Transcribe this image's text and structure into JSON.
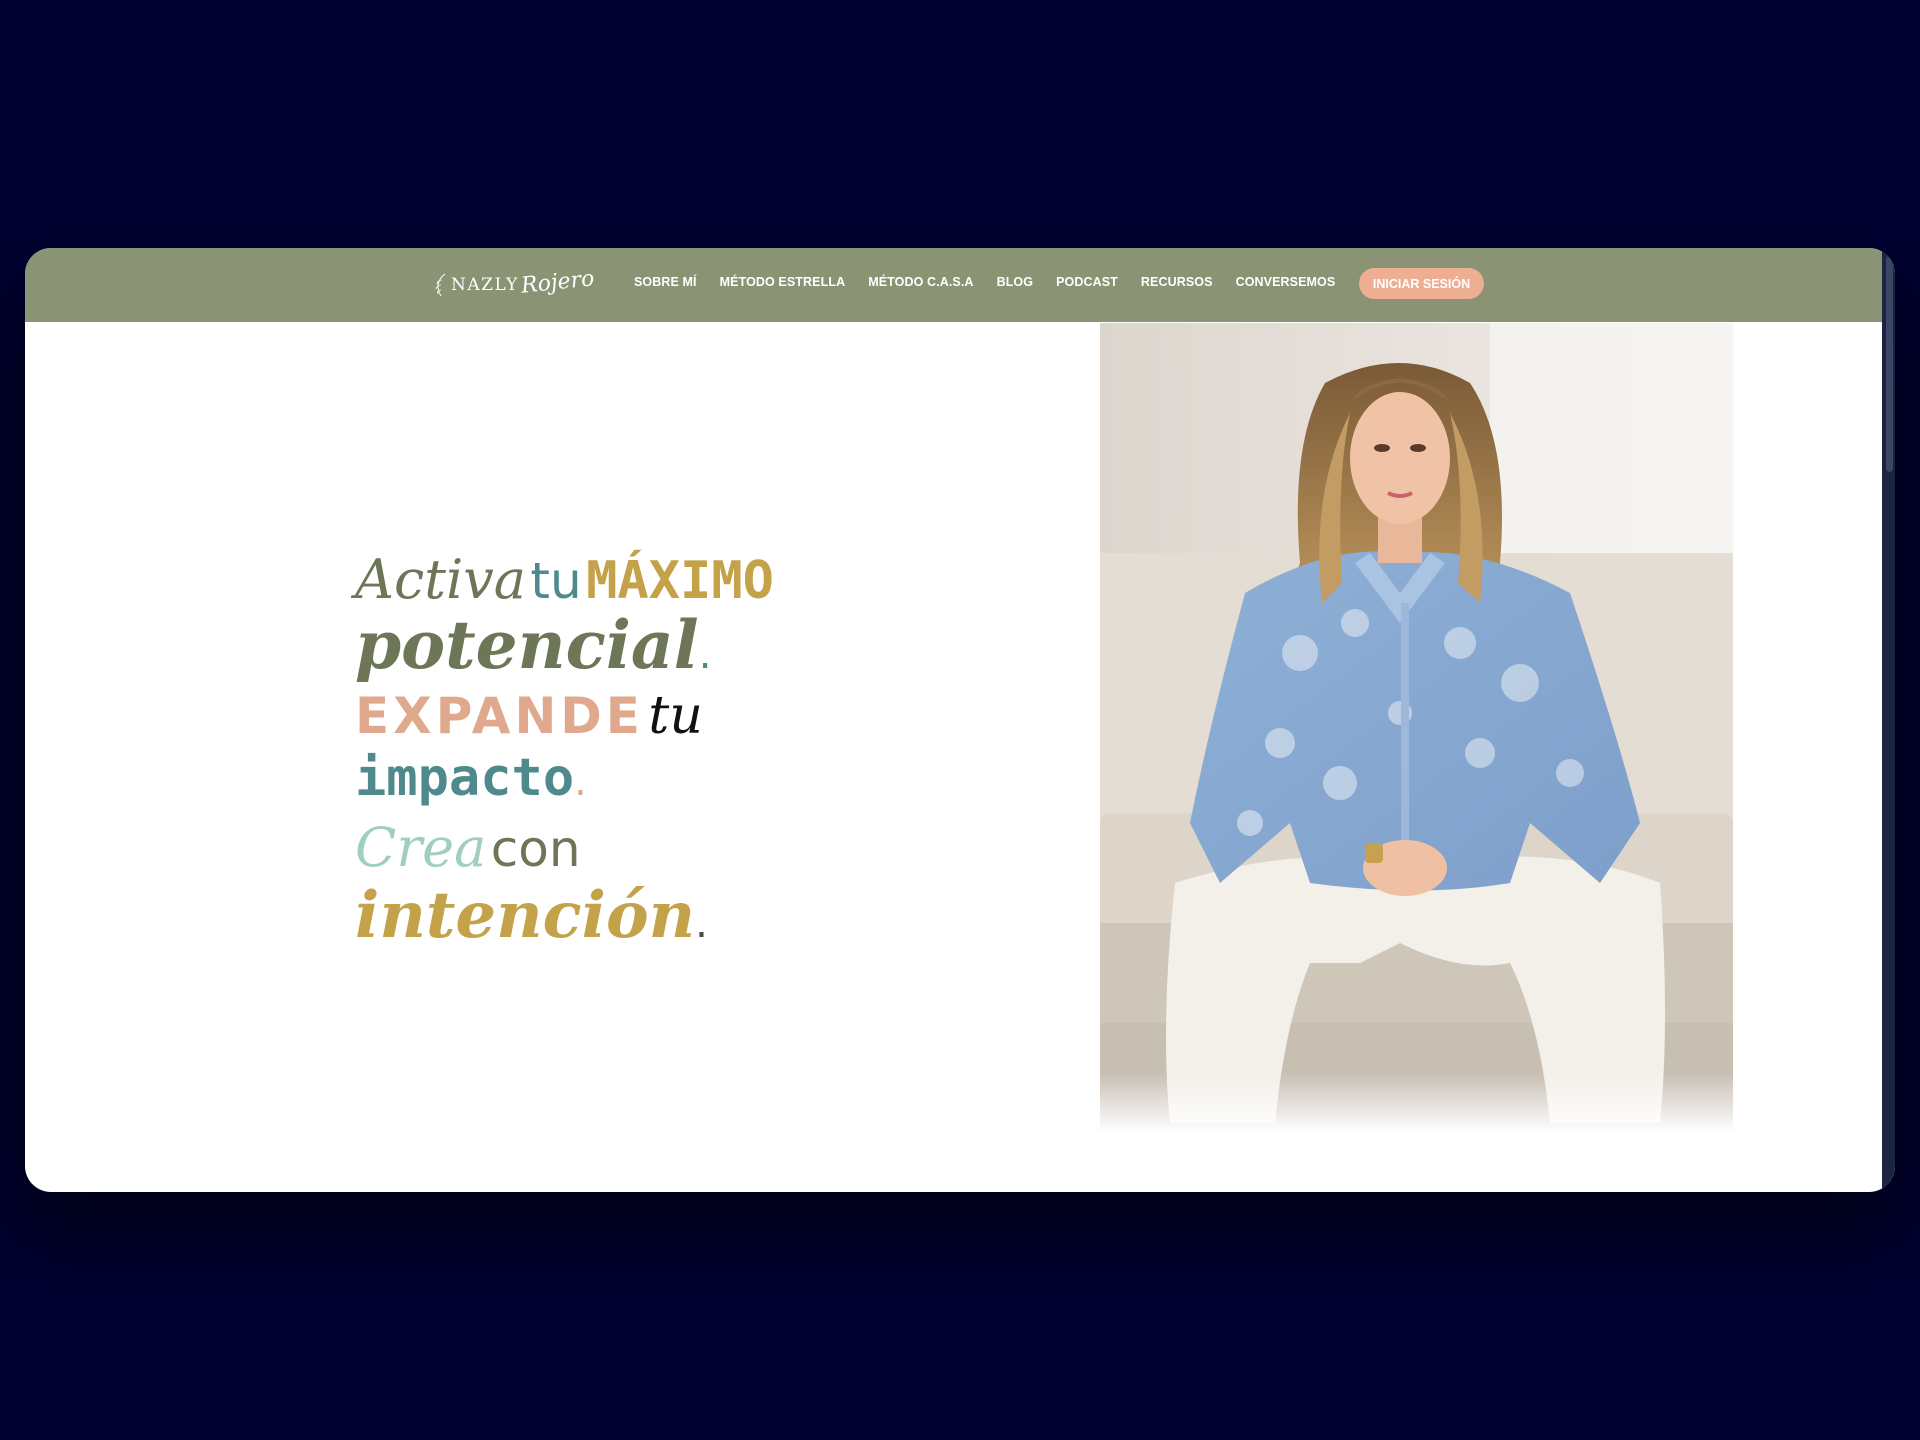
{
  "brand": {
    "logo_main": "NAZLY",
    "logo_script": "Rojero"
  },
  "nav": {
    "items": [
      "SOBRE MÍ",
      "MÉTODO ESTRELLA",
      "MÉTODO C.A.S.A",
      "BLOG",
      "PODCAST",
      "RECURSOS",
      "CONVERSEMOS"
    ],
    "login_label": "INICIAR SESIÓN"
  },
  "hero": {
    "line1": {
      "w1": "Activa",
      "w2": "tu",
      "w3": "MÁXIMO"
    },
    "line2": {
      "w1": "potencial",
      "dot": "."
    },
    "line3": {
      "w1": "EXPANDE",
      "w2": "tu"
    },
    "line4": {
      "w1": "impacto",
      "dot": "."
    },
    "line5": {
      "w1": "Crea",
      "w2": "con"
    },
    "line6": {
      "w1": "intención",
      "dot": "."
    }
  },
  "colors": {
    "header_bg": "#8a9474",
    "button_bg": "#edae92",
    "olive": "#6d7657",
    "gold": "#c3a24a",
    "peach": "#e0a98d",
    "teal": "#4e8a8c",
    "mint": "#9fcfc2",
    "page_bg": "#010230"
  }
}
